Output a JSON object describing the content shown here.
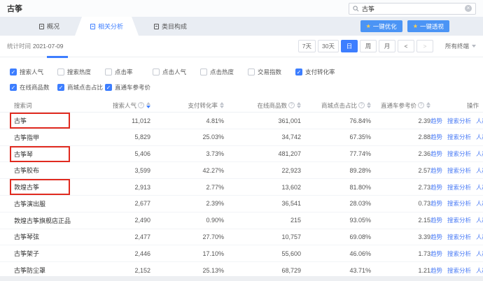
{
  "page": {
    "title": "古筝"
  },
  "search": {
    "value": "古筝"
  },
  "tabs": [
    {
      "name": "overview",
      "label": "概况",
      "active": false
    },
    {
      "name": "related-analysis",
      "label": "相关分析",
      "active": true
    },
    {
      "name": "category-composition",
      "label": "类目构成",
      "active": false
    }
  ],
  "header_actions": [
    {
      "name": "one-key-optimize",
      "label": "一键优化"
    },
    {
      "name": "one-key-perspective",
      "label": "一键透视"
    }
  ],
  "toolbar": {
    "stat_time_label": "统计时间",
    "stat_time_value": "2021-07-09",
    "range_buttons": [
      {
        "name": "7-days",
        "label": "7天",
        "active": false
      },
      {
        "name": "30-days",
        "label": "30天",
        "active": false
      },
      {
        "name": "day",
        "label": "日",
        "active": true
      },
      {
        "name": "week",
        "label": "周",
        "active": false
      },
      {
        "name": "month",
        "label": "月",
        "active": false
      }
    ],
    "prev_label": "<",
    "next_label": ">",
    "terminal_filter": "所有终端"
  },
  "metrics": {
    "rows": [
      [
        {
          "name": "search-popularity",
          "label": "搜索人气",
          "checked": true
        },
        {
          "name": "search-heat",
          "label": "搜索热度",
          "checked": false
        },
        {
          "name": "click-rate",
          "label": "点击率",
          "checked": false
        },
        {
          "name": "click-popularity",
          "label": "点击人气",
          "checked": false
        },
        {
          "name": "click-heat",
          "label": "点击热度",
          "checked": false
        },
        {
          "name": "transaction-index",
          "label": "交易指数",
          "checked": false
        },
        {
          "name": "payment-conversion-rate",
          "label": "支付转化率",
          "checked": true
        }
      ],
      [
        {
          "name": "online-products",
          "label": "在线商品数",
          "checked": true
        },
        {
          "name": "mall-click-ratio",
          "label": "商城点击占比",
          "checked": true
        },
        {
          "name": "ztc-reference-price",
          "label": "直通车参考价",
          "checked": true
        }
      ]
    ]
  },
  "table": {
    "columns": [
      {
        "name": "search-word",
        "label": "搜索词",
        "info": false,
        "sortable": false,
        "align": "left"
      },
      {
        "name": "search-popularity",
        "label": "搜索人气",
        "info": true,
        "sortable": true,
        "sorted": "desc",
        "align": "right"
      },
      {
        "name": "payment-conversion-rate",
        "label": "支付转化率",
        "info": false,
        "sortable": true,
        "align": "right"
      },
      {
        "name": "online-products",
        "label": "在线商品数",
        "info": true,
        "sortable": true,
        "align": "right"
      },
      {
        "name": "mall-click-ratio",
        "label": "商城点击占比",
        "info": true,
        "sortable": true,
        "align": "right"
      },
      {
        "name": "ztc-reference-price",
        "label": "直通车参考价",
        "info": true,
        "sortable": true,
        "align": "right"
      },
      {
        "name": "operation",
        "label": "操作",
        "info": false,
        "sortable": false,
        "align": "right"
      }
    ],
    "action_links": [
      {
        "name": "trend",
        "label": "趋势"
      },
      {
        "name": "search-analysis",
        "label": "搜索分析"
      },
      {
        "name": "crowd-analysis",
        "label": "人群分析"
      }
    ],
    "rows": [
      {
        "word": "古筝",
        "highlight": true,
        "values": [
          "11,012",
          "4.81%",
          "361,001",
          "76.84%",
          "2.39"
        ]
      },
      {
        "word": "古筝指甲",
        "highlight": false,
        "values": [
          "5,829",
          "25.03%",
          "34,742",
          "67.35%",
          "2.88"
        ]
      },
      {
        "word": "古筝琴",
        "highlight": true,
        "values": [
          "5,406",
          "3.73%",
          "481,207",
          "77.74%",
          "2.36"
        ]
      },
      {
        "word": "古筝胶布",
        "highlight": false,
        "values": [
          "3,599",
          "42.27%",
          "22,923",
          "89.28%",
          "2.57"
        ]
      },
      {
        "word": "敦煌古筝",
        "highlight": true,
        "values": [
          "2,913",
          "2.77%",
          "13,602",
          "81.80%",
          "2.73"
        ]
      },
      {
        "word": "古筝演出服",
        "highlight": false,
        "values": [
          "2,677",
          "2.39%",
          "36,541",
          "28.03%",
          "0.73"
        ]
      },
      {
        "word": "敦煌古筝旗舰店正品",
        "highlight": false,
        "values": [
          "2,490",
          "0.90%",
          "215",
          "93.05%",
          "2.15"
        ]
      },
      {
        "word": "古筝琴弦",
        "highlight": false,
        "values": [
          "2,477",
          "27.70%",
          "10,757",
          "69.08%",
          "3.39"
        ]
      },
      {
        "word": "古筝架子",
        "highlight": false,
        "values": [
          "2,446",
          "17.10%",
          "55,600",
          "46.06%",
          "1.73"
        ]
      },
      {
        "word": "古筝防尘罩",
        "highlight": false,
        "values": [
          "2,152",
          "25.13%",
          "68,729",
          "43.71%",
          "1.21"
        ]
      }
    ]
  },
  "colors": {
    "accent_blue": "#3d7eff",
    "button_blue": "#4b94f5",
    "link_blue": "#4a7bf5",
    "star_yellow": "#ffd04c",
    "highlight_red": "#e02a1f",
    "tab_band_bg": "#e9edf3"
  }
}
